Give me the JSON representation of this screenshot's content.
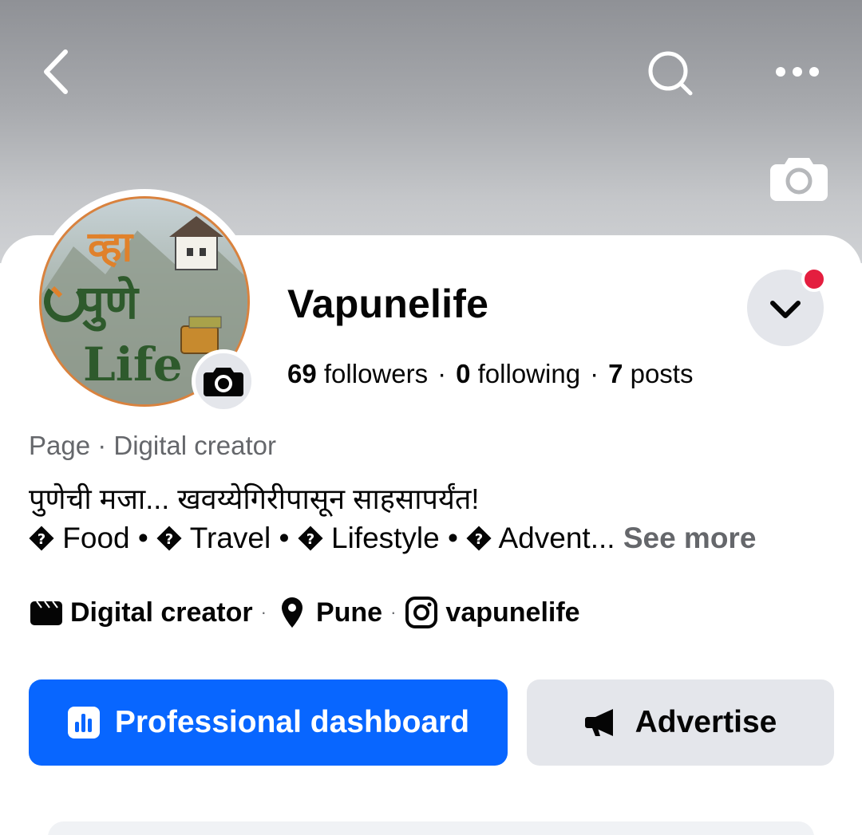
{
  "header": {
    "back_icon": "chevron-left-icon",
    "search_icon": "search-icon",
    "more_icon": "more-horizontal-icon",
    "cover_camera_icon": "camera-icon"
  },
  "profile": {
    "name": "Vapunelife",
    "followers_count": "69",
    "followers_label": "followers",
    "following_count": "0",
    "following_label": "following",
    "posts_count": "7",
    "posts_label": "posts",
    "stat_separator": "·",
    "category": "Page · Digital creator",
    "bio_line1": "पुणेची मजा... खवय्येगिरीपासून साहसापर्यंत!",
    "bio_items": [
      "Food •",
      "Travel •",
      "Lifestyle •",
      "Advent..."
    ],
    "bio_unknown_glyph": "�",
    "see_more_label": "See more",
    "avatar_logo_text": [
      "व्हा",
      "पुणे",
      "Life"
    ]
  },
  "details": {
    "category_label": "Digital creator",
    "location_label": "Pune",
    "instagram_label": "vapunelife",
    "separator": "·"
  },
  "actions": {
    "primary_label": "Professional dashboard",
    "secondary_label": "Advertise"
  },
  "colors": {
    "primary_blue": "#0866ff",
    "secondary_gray": "#e4e6eb",
    "muted_text": "#65676b",
    "notification_red": "#e41e3f"
  }
}
